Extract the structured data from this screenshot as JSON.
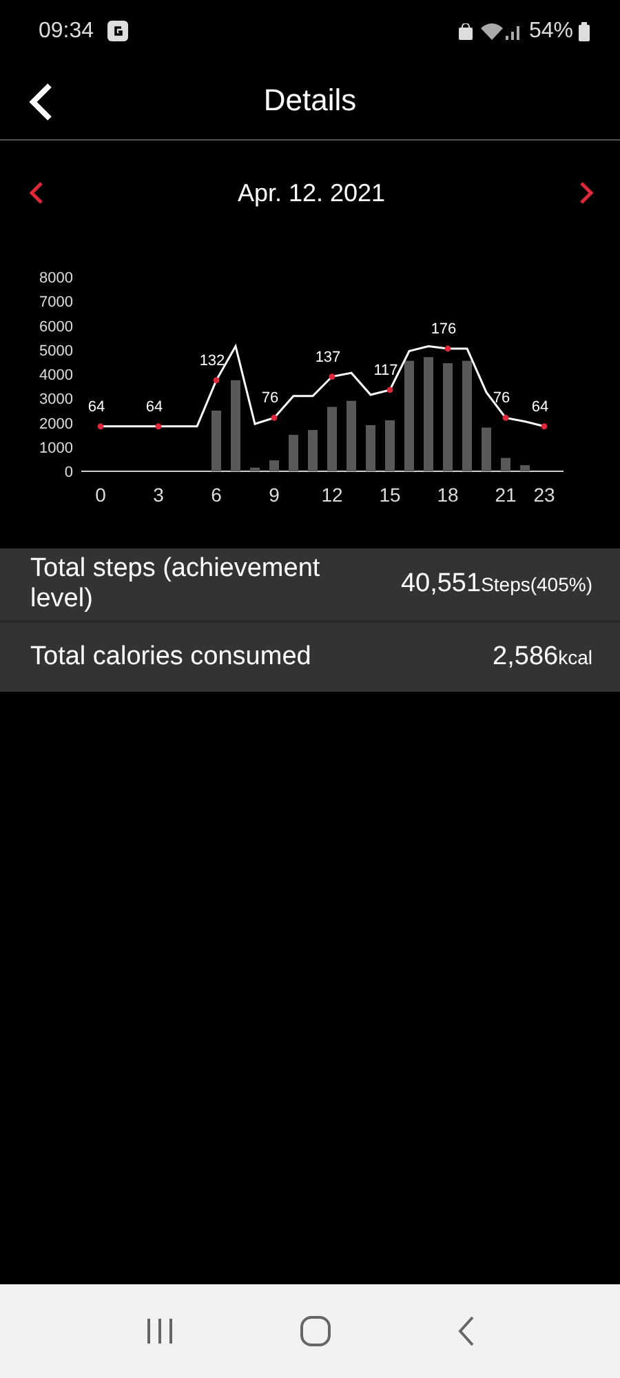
{
  "status_bar": {
    "time": "09:34",
    "battery": "54%"
  },
  "header": {
    "title": "Details"
  },
  "date_nav": {
    "date": "Apr. 12. 2021"
  },
  "chart": {
    "chart_data": {
      "type": "bar",
      "x": [
        0,
        1,
        2,
        3,
        4,
        5,
        6,
        7,
        8,
        9,
        10,
        11,
        12,
        13,
        14,
        15,
        16,
        17,
        18,
        19,
        20,
        21,
        22,
        23
      ],
      "series": [
        {
          "type": "bar",
          "color": "#595959",
          "values": [
            0,
            0,
            0,
            0,
            0,
            0,
            2500,
            3750,
            150,
            450,
            1500,
            1700,
            2650,
            2900,
            1900,
            2100,
            4550,
            4700,
            4450,
            4550,
            1800,
            550,
            250,
            0
          ]
        },
        {
          "type": "line",
          "color": "#ffffff",
          "values": [
            1850,
            1850,
            1850,
            1850,
            1850,
            1850,
            3750,
            5150,
            1950,
            2200,
            3100,
            3100,
            3900,
            4050,
            3150,
            3350,
            4950,
            5150,
            5050,
            5050,
            3250,
            2200,
            2050,
            1850
          ]
        }
      ],
      "xlim": [
        -1,
        24
      ],
      "ylim": [
        0,
        8000
      ],
      "yticks": [
        0,
        1000,
        2000,
        3000,
        4000,
        5000,
        6000,
        7000,
        8000
      ],
      "xticks": [
        0,
        3,
        6,
        9,
        12,
        15,
        18,
        21,
        23
      ],
      "annotations": [
        {
          "x": 0,
          "y": 1850,
          "text": "64"
        },
        {
          "x": 3,
          "y": 1850,
          "text": "64"
        },
        {
          "x": 6,
          "y": 3750,
          "text": "132"
        },
        {
          "x": 9,
          "y": 2200,
          "text": "76"
        },
        {
          "x": 12,
          "y": 3900,
          "text": "137"
        },
        {
          "x": 15,
          "y": 3350,
          "text": "117"
        },
        {
          "x": 18,
          "y": 5050,
          "text": "176"
        },
        {
          "x": 21,
          "y": 2200,
          "text": "76"
        },
        {
          "x": 23,
          "y": 1850,
          "text": "64"
        }
      ]
    }
  },
  "summary": [
    {
      "label": "Total steps (achievement level)",
      "value": "40,551",
      "unit": "Steps(405%)"
    },
    {
      "label": "Total calories consumed",
      "value": "2,586",
      "unit": "kcal"
    }
  ]
}
